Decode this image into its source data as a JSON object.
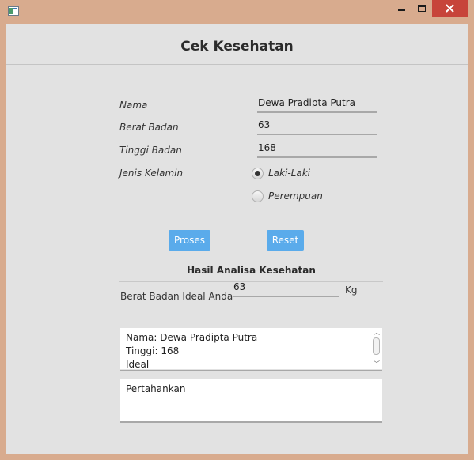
{
  "window": {
    "controls": {
      "minimize_icon": "minimize-icon",
      "maximize_icon": "maximize-icon",
      "close_icon": "close-icon"
    },
    "close_color": "#c7443a",
    "frame_color": "#d8ab8e"
  },
  "header": {
    "title": "Cek Kesehatan"
  },
  "form": {
    "nama_label": "Nama",
    "nama_value": "Dewa Pradipta Putra",
    "berat_label": "Berat Badan",
    "berat_value": "63",
    "tinggi_label": "Tinggi Badan",
    "tinggi_value": "168",
    "jenis_label": "Jenis Kelamin",
    "gender_options": [
      "Laki-Laki",
      "Perempuan"
    ],
    "gender_selected": "Laki-Laki"
  },
  "buttons": {
    "proses": "Proses",
    "reset": "Reset",
    "color": "#5aabeb"
  },
  "result": {
    "section_title": "Hasil Analisa Kesehatan",
    "ideal_label": "Berat Badan Ideal Anda",
    "ideal_value": "63",
    "ideal_unit": "Kg",
    "summary_lines": [
      "Nama: Dewa Pradipta Putra",
      "Tinggi: 168",
      "Ideal"
    ],
    "advice": "Pertahankan"
  }
}
